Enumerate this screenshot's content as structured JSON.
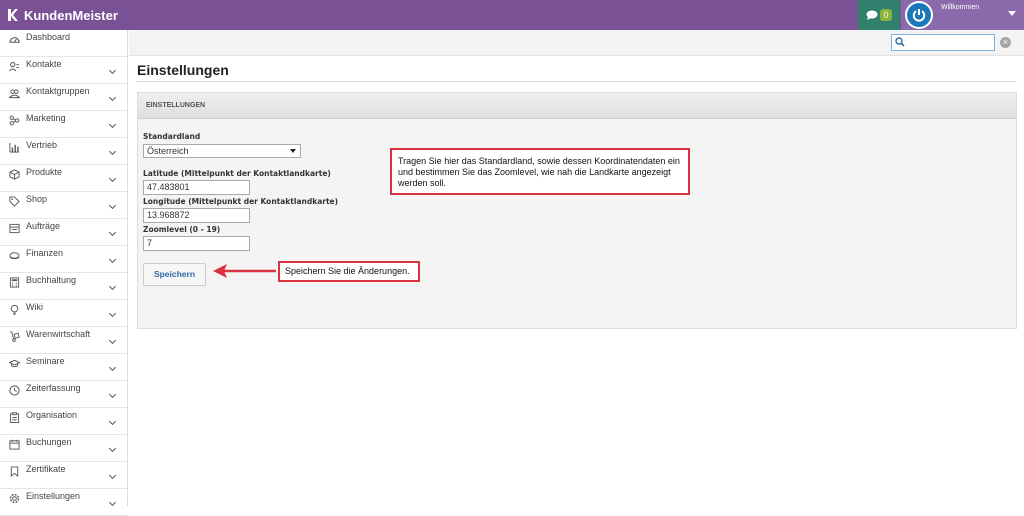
{
  "app": {
    "name": "KundenMeister"
  },
  "topbar": {
    "chat_count": "0",
    "welcome": "Willkommen"
  },
  "sidebar": {
    "items": [
      {
        "label": "Dashboard",
        "icon": "dashboard-icon",
        "has_chevron": false
      },
      {
        "label": "Kontakte",
        "icon": "contacts-icon",
        "has_chevron": true
      },
      {
        "label": "Kontaktgruppen",
        "icon": "groups-icon",
        "has_chevron": true
      },
      {
        "label": "Marketing",
        "icon": "marketing-icon",
        "has_chevron": true
      },
      {
        "label": "Vertrieb",
        "icon": "sales-chart-icon",
        "has_chevron": true
      },
      {
        "label": "Produkte",
        "icon": "box-icon",
        "has_chevron": true
      },
      {
        "label": "Shop",
        "icon": "tag-icon",
        "has_chevron": true
      },
      {
        "label": "Aufträge",
        "icon": "orders-icon",
        "has_chevron": true
      },
      {
        "label": "Finanzen",
        "icon": "money-icon",
        "has_chevron": true
      },
      {
        "label": "Buchhaltung",
        "icon": "calculator-icon",
        "has_chevron": true
      },
      {
        "label": "Wiki",
        "icon": "lightbulb-icon",
        "has_chevron": true
      },
      {
        "label": "Warenwirtschaft",
        "icon": "hand-truck-icon",
        "has_chevron": true
      },
      {
        "label": "Seminare",
        "icon": "graduation-cap-icon",
        "has_chevron": true
      },
      {
        "label": "Zeiterfassung",
        "icon": "clock-icon",
        "has_chevron": true
      },
      {
        "label": "Organisation",
        "icon": "clipboard-icon",
        "has_chevron": true
      },
      {
        "label": "Buchungen",
        "icon": "calendar-icon",
        "has_chevron": true
      },
      {
        "label": "Zertifikate",
        "icon": "bookmark-icon",
        "has_chevron": true
      },
      {
        "label": "Einstellungen",
        "icon": "gear-icon",
        "has_chevron": true
      }
    ]
  },
  "search": {
    "placeholder": ""
  },
  "page": {
    "title": "Einstellungen"
  },
  "panel": {
    "header": "EINSTELLUNGEN",
    "standardland_label": "Standardland",
    "standardland_value": "Österreich",
    "latitude_label": "Latitude (Mittelpunkt der Kontaktlandkarte)",
    "latitude_value": "47.483801",
    "longitude_label": "Longitude (Mittelpunkt der Kontaktlandkarte)",
    "longitude_value": "13.968872",
    "zoom_label": "Zoomlevel (0 - 19)",
    "zoom_value": "7",
    "save_label": "Speichern"
  },
  "annotations": {
    "note_fields": "Tragen Sie hier das Standardland, sowie dessen Koordinatendaten ein und bestimmen Sie das Zoomlevel, wie nah die Landkarte angezeigt werden soll.",
    "note_save": "Speichern Sie die Änderungen.",
    "accent_color": "#d9333f"
  },
  "colors": {
    "topbar": "#7a5194",
    "chat": "#31806d",
    "user": "#8a6aaa",
    "link": "#2d6aa3"
  }
}
